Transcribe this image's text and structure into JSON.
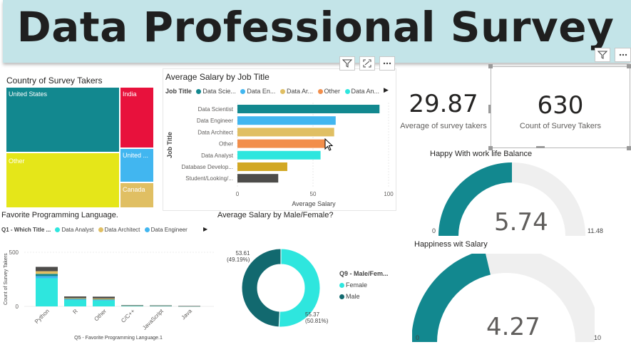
{
  "header": {
    "title": "Data Professional Survey"
  },
  "colors": {
    "teal": "#118DFF",
    "dark_teal": "#12888f",
    "yellow": "#e5e619",
    "red": "#e8113c",
    "sky": "#41b6f0",
    "gold": "#e0bf63",
    "orange": "#f28e4b",
    "aqua": "#2ee6de",
    "charcoal": "#4d4c4a",
    "mustard": "#d2a824"
  },
  "treemap": {
    "title": "Country of Survey Takers",
    "cells": [
      {
        "label": "United States",
        "color": "#12888f"
      },
      {
        "label": "India",
        "color": "#e8113c"
      },
      {
        "label": "Other",
        "color": "#e5e619"
      },
      {
        "label": "United ...",
        "color": "#41b6f0"
      },
      {
        "label": "Canada",
        "color": "#e0bf63"
      }
    ]
  },
  "salary_by_job": {
    "title": "Average Salary by Job Title",
    "legend_title": "Job Title",
    "legend": [
      {
        "label": "Data Scie...",
        "color": "#12888f"
      },
      {
        "label": "Data En...",
        "color": "#41b6f0"
      },
      {
        "label": "Data Ar...",
        "color": "#e0bf63"
      },
      {
        "label": "Other",
        "color": "#f28e4b"
      },
      {
        "label": "Data An...",
        "color": "#2ee6de"
      }
    ],
    "y_axis_label": "Job Title",
    "x_axis_label": "Average Salary",
    "x_ticks": [
      "0",
      "50",
      "100"
    ]
  },
  "programming": {
    "title": "Favorite Programming Language.",
    "legend_title": "Q1 - Which Title ...",
    "legend": [
      {
        "label": "Data Analyst",
        "color": "#2ee6de"
      },
      {
        "label": "Data Architect",
        "color": "#e0bf63"
      },
      {
        "label": "Data Engineer",
        "color": "#41b6f0"
      }
    ],
    "y_axis_label": "Count of Survey Takers",
    "x_axis_label": "Q5 - Favorite Programming Language.1",
    "y_ticks": [
      "500",
      "0"
    ]
  },
  "gender_salary": {
    "title": "Average Salary by Male/Female?",
    "legend_title": "Q9 - Male/Fem...",
    "legend": [
      {
        "label": "Female",
        "color": "#2ee6de"
      },
      {
        "label": "Male",
        "color": "#12696f"
      }
    ],
    "male_label": "53.61",
    "male_pct": "(49.19%)",
    "female_label": "55.37",
    "female_pct": "(50.81%)"
  },
  "cards": {
    "avg_age_value": "29.87",
    "avg_age_label": "Average of survey takers",
    "count_value": "630",
    "count_label": "Count of Survey Takers"
  },
  "gauge_worklife": {
    "title": "Happy With work life Balance",
    "value": "5.74",
    "min": "0",
    "max": "11.48",
    "fraction": 0.5
  },
  "gauge_salary": {
    "title": "Happiness wit Salary",
    "value": "4.27",
    "min": "0",
    "max": "10",
    "fraction": 0.427
  },
  "chart_data": [
    {
      "type": "bar",
      "title": "Average Salary by Job Title",
      "xlabel": "Average Salary",
      "ylabel": "Job Title",
      "orientation": "horizontal",
      "xlim": [
        0,
        100
      ],
      "categories": [
        "Data Scientist",
        "Data Engineer",
        "Data Architect",
        "Other",
        "Data Analyst",
        "Database Develop...",
        "Student/Looking/..."
      ],
      "values": [
        94,
        65,
        64,
        59,
        55,
        33,
        27
      ],
      "colors": [
        "#12888f",
        "#41b6f0",
        "#e0bf63",
        "#f28e4b",
        "#2ee6de",
        "#d2a824",
        "#4d4c4a"
      ],
      "grid": true
    },
    {
      "type": "bar",
      "stacked": true,
      "title": "Favorite Programming Language.",
      "xlabel": "Q5 - Favorite Programming Language.1",
      "ylabel": "Count of Survey Takers",
      "ylim": [
        0,
        500
      ],
      "categories": [
        "Python",
        "R",
        "Other",
        "C/C++",
        "JavaScript",
        "Java"
      ],
      "series": [
        {
          "name": "Data Analyst",
          "color": "#2ee6de",
          "values": [
            260,
            60,
            55,
            6,
            5,
            2
          ]
        },
        {
          "name": "Data Engineer",
          "color": "#41b6f0",
          "values": [
            20,
            5,
            5,
            1,
            1,
            1
          ]
        },
        {
          "color": "#12888f",
          "values": [
            20,
            6,
            5,
            1,
            1,
            0
          ]
        },
        {
          "name": "Data Architect",
          "color": "#e0bf63",
          "values": [
            25,
            6,
            8,
            1,
            1,
            0
          ]
        },
        {
          "color": "#4d4c4a",
          "values": [
            40,
            15,
            17,
            2,
            1,
            1
          ]
        }
      ]
    },
    {
      "type": "pie",
      "donut": true,
      "title": "Average Salary by Male/Female?",
      "categories": [
        "Female",
        "Male"
      ],
      "values": [
        55.37,
        53.61
      ],
      "percents": [
        50.81,
        49.19
      ],
      "colors": [
        "#2ee6de",
        "#12696f"
      ]
    }
  ]
}
